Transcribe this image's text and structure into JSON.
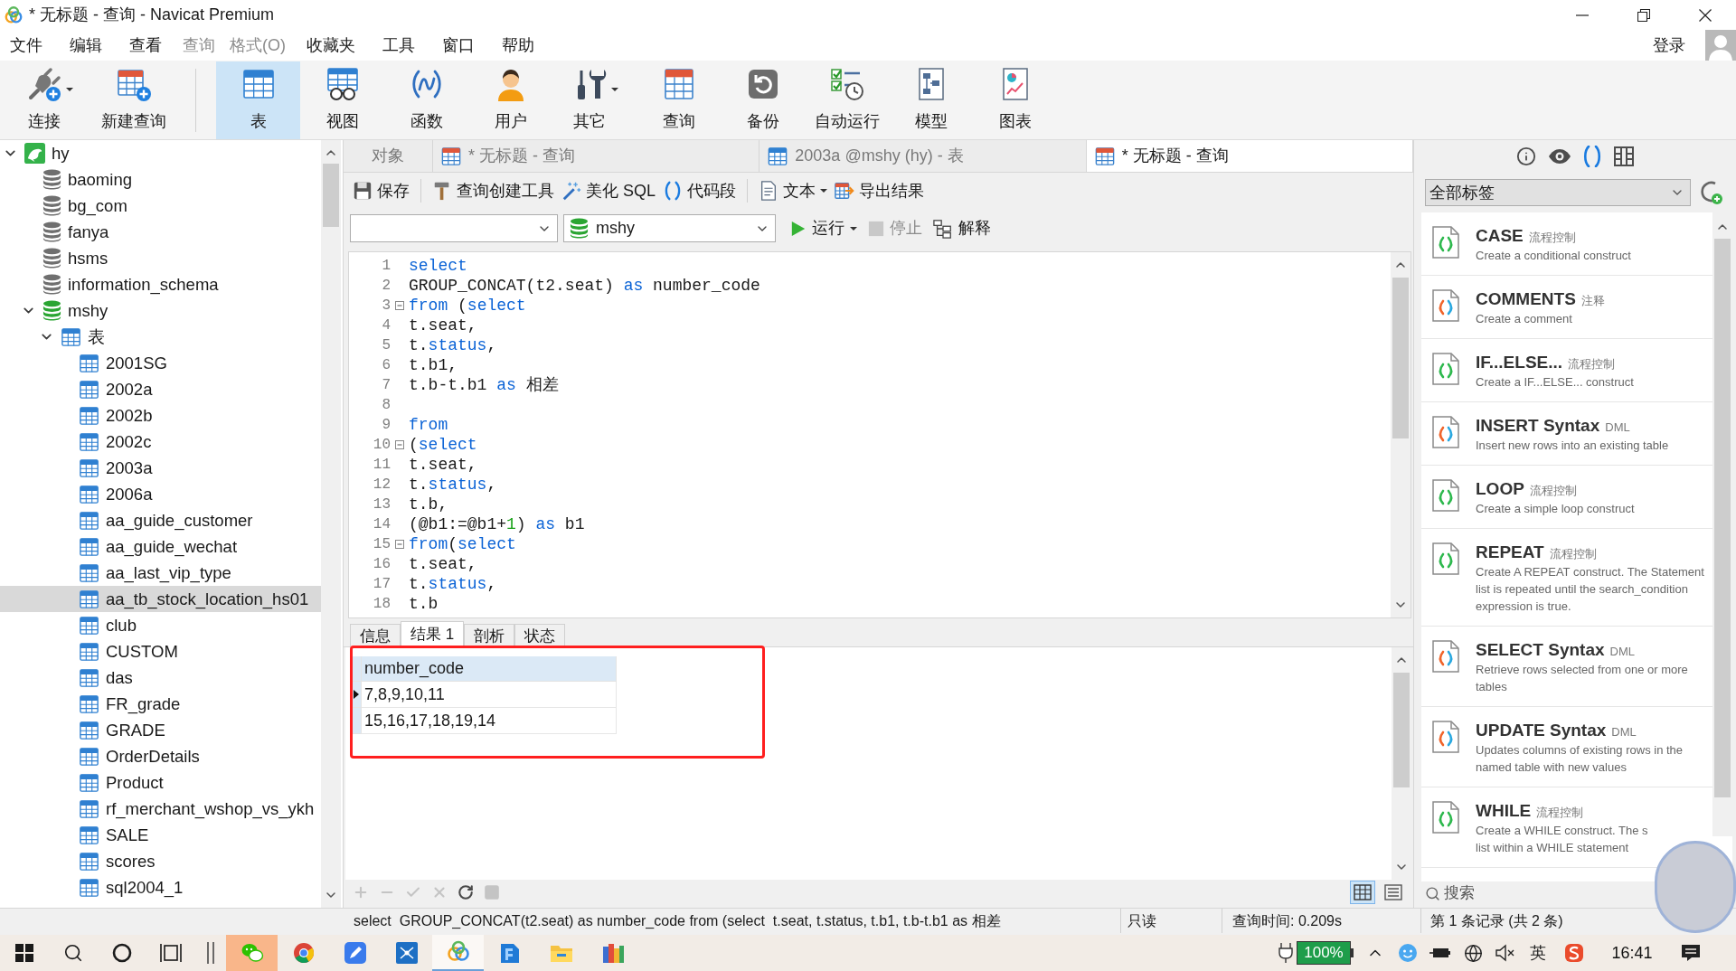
{
  "window": {
    "title": "* 无标题 - 查询 - Navicat Premium"
  },
  "menu": [
    {
      "label": "文件",
      "disabled": false
    },
    {
      "label": "编辑",
      "disabled": false
    },
    {
      "label": "查看",
      "disabled": false
    },
    {
      "label": "查询",
      "disabled": true
    },
    {
      "label": "格式(O)",
      "disabled": true
    },
    {
      "label": "收藏夹",
      "disabled": false
    },
    {
      "label": "工具",
      "disabled": false
    },
    {
      "label": "窗口",
      "disabled": false
    },
    {
      "label": "帮助",
      "disabled": false
    }
  ],
  "account": {
    "label": "登录"
  },
  "toolbar": {
    "primary": [
      {
        "label": "连接",
        "kind": "connect",
        "dropdown": true,
        "selected": false
      },
      {
        "label": "新建查询",
        "kind": "new-query",
        "dropdown": false,
        "selected": false
      }
    ],
    "objects": [
      {
        "label": "表",
        "kind": "table",
        "dropdown": false,
        "selected": true
      },
      {
        "label": "视图",
        "kind": "view",
        "dropdown": false,
        "selected": false
      },
      {
        "label": "函数",
        "kind": "function",
        "dropdown": false,
        "selected": false
      },
      {
        "label": "用户",
        "kind": "user",
        "dropdown": false,
        "selected": false
      },
      {
        "label": "其它",
        "kind": "other",
        "dropdown": true,
        "selected": false
      },
      {
        "label": "查询",
        "kind": "query",
        "dropdown": false,
        "selected": false
      },
      {
        "label": "备份",
        "kind": "backup",
        "dropdown": false,
        "selected": false
      },
      {
        "label": "自动运行",
        "kind": "automation",
        "dropdown": false,
        "selected": false
      },
      {
        "label": "模型",
        "kind": "model",
        "dropdown": false,
        "selected": false
      },
      {
        "label": "图表",
        "kind": "chart",
        "dropdown": false,
        "selected": false
      }
    ]
  },
  "tree": [
    {
      "label": "hy",
      "kind": "connection",
      "expanded": true,
      "selected": false,
      "children": [
        {
          "label": "baoming",
          "kind": "database",
          "open": false,
          "selected": false
        },
        {
          "label": "bg_com",
          "kind": "database",
          "open": false,
          "selected": false
        },
        {
          "label": "fanya",
          "kind": "database",
          "open": false,
          "selected": false
        },
        {
          "label": "hsms",
          "kind": "database",
          "open": false,
          "selected": false
        },
        {
          "label": "information_schema",
          "kind": "database",
          "open": false,
          "selected": false
        },
        {
          "label": "mshy",
          "kind": "database",
          "open": true,
          "expanded": true,
          "selected": false,
          "children": [
            {
              "label": "表",
              "kind": "group",
              "expanded": true,
              "selected": false,
              "children": [
                {
                  "label": "2001SG",
                  "kind": "table",
                  "selected": false
                },
                {
                  "label": "2002a",
                  "kind": "table",
                  "selected": false
                },
                {
                  "label": "2002b",
                  "kind": "table",
                  "selected": false
                },
                {
                  "label": "2002c",
                  "kind": "table",
                  "selected": false
                },
                {
                  "label": "2003a",
                  "kind": "table",
                  "selected": false
                },
                {
                  "label": "2006a",
                  "kind": "table",
                  "selected": false
                },
                {
                  "label": "aa_guide_customer",
                  "kind": "table",
                  "selected": false
                },
                {
                  "label": "aa_guide_wechat",
                  "kind": "table",
                  "selected": false
                },
                {
                  "label": "aa_last_vip_type",
                  "kind": "table",
                  "selected": false
                },
                {
                  "label": "aa_tb_stock_location_hs01",
                  "kind": "table",
                  "selected": true
                },
                {
                  "label": "club",
                  "kind": "table",
                  "selected": false
                },
                {
                  "label": "CUSTOM",
                  "kind": "table",
                  "selected": false
                },
                {
                  "label": "das",
                  "kind": "table",
                  "selected": false
                },
                {
                  "label": "FR_grade",
                  "kind": "table",
                  "selected": false
                },
                {
                  "label": "GRADE",
                  "kind": "table",
                  "selected": false
                },
                {
                  "label": "OrderDetails",
                  "kind": "table",
                  "selected": false
                },
                {
                  "label": "Product",
                  "kind": "table",
                  "selected": false
                },
                {
                  "label": "rf_merchant_wshop_vs_ykh",
                  "kind": "table",
                  "selected": false
                },
                {
                  "label": "SALE",
                  "kind": "table",
                  "selected": false
                },
                {
                  "label": "scores",
                  "kind": "table",
                  "selected": false
                },
                {
                  "label": "sql2004_1",
                  "kind": "table",
                  "selected": false
                }
              ]
            }
          ]
        }
      ]
    }
  ],
  "tabs": [
    {
      "label": "对象",
      "kind": "object",
      "selected": false
    },
    {
      "label": "* 无标题 - 查询",
      "kind": "query",
      "selected": false
    },
    {
      "label": "2003a @mshy (hy) - 表",
      "kind": "table",
      "selected": false
    },
    {
      "label": "* 无标题 - 查询",
      "kind": "query",
      "selected": true
    }
  ],
  "query_toolbar": [
    [
      {
        "label": "保存",
        "kind": "save",
        "dropdown": false
      }
    ],
    [
      {
        "label": "查询创建工具",
        "kind": "builder",
        "dropdown": false
      },
      {
        "label": "美化 SQL",
        "kind": "beautify",
        "dropdown": false
      },
      {
        "label": "代码段",
        "kind": "snippet",
        "dropdown": false
      }
    ],
    [
      {
        "label": "文本",
        "kind": "text",
        "dropdown": true
      },
      {
        "label": "导出结果",
        "kind": "export",
        "dropdown": false
      }
    ]
  ],
  "database_select": {
    "value": "mshy"
  },
  "run_controls": [
    {
      "label": "运行",
      "kind": "run",
      "dropdown": true,
      "disabled": false
    },
    {
      "label": "停止",
      "kind": "stop",
      "dropdown": false,
      "disabled": true
    },
    {
      "label": "解释",
      "kind": "explain",
      "dropdown": false,
      "disabled": false
    }
  ],
  "editor": {
    "lines": [
      {
        "number": "1",
        "fold": false,
        "tokens": [
          {
            "text": "select",
            "kind": "keyword"
          }
        ]
      },
      {
        "number": "2",
        "fold": false,
        "tokens": [
          {
            "text": "GROUP_CONCAT(t2.seat) ",
            "kind": "plain"
          },
          {
            "text": "as",
            "kind": "keyword"
          },
          {
            "text": " number_code",
            "kind": "plain"
          }
        ]
      },
      {
        "number": "3",
        "fold": true,
        "tokens": [
          {
            "text": "from",
            "kind": "keyword"
          },
          {
            "text": " (",
            "kind": "plain"
          },
          {
            "text": "select",
            "kind": "keyword"
          }
        ]
      },
      {
        "number": "4",
        "fold": false,
        "tokens": [
          {
            "text": "t.seat,",
            "kind": "plain"
          }
        ]
      },
      {
        "number": "5",
        "fold": false,
        "tokens": [
          {
            "text": "t.",
            "kind": "plain"
          },
          {
            "text": "status",
            "kind": "keyword"
          },
          {
            "text": ",",
            "kind": "plain"
          }
        ]
      },
      {
        "number": "6",
        "fold": false,
        "tokens": [
          {
            "text": "t.b1,",
            "kind": "plain"
          }
        ]
      },
      {
        "number": "7",
        "fold": false,
        "tokens": [
          {
            "text": "t.b-t.b1 ",
            "kind": "plain"
          },
          {
            "text": "as",
            "kind": "keyword"
          },
          {
            "text": " 相差",
            "kind": "plain"
          }
        ]
      },
      {
        "number": "8",
        "fold": false
      },
      {
        "number": "9",
        "fold": false,
        "tokens": [
          {
            "text": "from",
            "kind": "keyword"
          }
        ]
      },
      {
        "number": "10",
        "fold": true,
        "tokens": [
          {
            "text": "(",
            "kind": "plain"
          },
          {
            "text": "select",
            "kind": "keyword"
          }
        ]
      },
      {
        "number": "11",
        "fold": false,
        "tokens": [
          {
            "text": "t.seat,",
            "kind": "plain"
          }
        ]
      },
      {
        "number": "12",
        "fold": false,
        "tokens": [
          {
            "text": "t.",
            "kind": "plain"
          },
          {
            "text": "status",
            "kind": "keyword"
          },
          {
            "text": ",",
            "kind": "plain"
          }
        ]
      },
      {
        "number": "13",
        "fold": false,
        "tokens": [
          {
            "text": "t.b,",
            "kind": "plain"
          }
        ]
      },
      {
        "number": "14",
        "fold": false,
        "tokens": [
          {
            "text": "(@b1:=@b1+",
            "kind": "plain"
          },
          {
            "text": "1",
            "kind": "number"
          },
          {
            "text": ") ",
            "kind": "plain"
          },
          {
            "text": "as",
            "kind": "keyword"
          },
          {
            "text": " b1",
            "kind": "plain"
          }
        ]
      },
      {
        "number": "15",
        "fold": true,
        "tokens": [
          {
            "text": "from",
            "kind": "keyword"
          },
          {
            "text": "(",
            "kind": "plain"
          },
          {
            "text": "select",
            "kind": "keyword"
          }
        ]
      },
      {
        "number": "16",
        "fold": false,
        "tokens": [
          {
            "text": "t.seat,",
            "kind": "plain"
          }
        ]
      },
      {
        "number": "17",
        "fold": false,
        "tokens": [
          {
            "text": "t.",
            "kind": "plain"
          },
          {
            "text": "status",
            "kind": "keyword"
          },
          {
            "text": ",",
            "kind": "plain"
          }
        ]
      },
      {
        "number": "18",
        "fold": false,
        "tokens": [
          {
            "text": "t.b",
            "kind": "plain"
          }
        ]
      }
    ]
  },
  "result_tabs": [
    {
      "label": "信息",
      "selected": false
    },
    {
      "label": "结果 1",
      "selected": true
    },
    {
      "label": "剖析",
      "selected": false
    },
    {
      "label": "状态",
      "selected": false
    }
  ],
  "result_grid": {
    "columns": [
      "number_code"
    ],
    "rows": [
      {
        "cells": [
          "7,8,9,10,11"
        ],
        "selected": true
      },
      {
        "cells": [
          "15,16,17,18,19,14"
        ],
        "selected": false
      }
    ]
  },
  "grid_actions": [
    {
      "kind": "add",
      "disabled": true
    },
    {
      "kind": "remove",
      "disabled": true
    },
    {
      "kind": "apply",
      "disabled": true
    },
    {
      "kind": "cancel",
      "disabled": true
    },
    {
      "kind": "refresh",
      "disabled": false
    },
    {
      "kind": "stop",
      "disabled": true
    }
  ],
  "view_modes": [
    {
      "kind": "grid",
      "selected": true
    },
    {
      "kind": "form",
      "selected": false
    }
  ],
  "right_panel": {
    "tabs": [
      {
        "kind": "info",
        "selected": false
      },
      {
        "kind": "preview",
        "selected": false
      },
      {
        "kind": "snippets",
        "selected": true
      },
      {
        "kind": "layout",
        "selected": false
      }
    ],
    "filter": {
      "value": "全部标签"
    },
    "snippets": [
      {
        "title": "CASE",
        "tag": "流程控制",
        "description": "Create a conditional construct",
        "kind": "control"
      },
      {
        "title": "COMMENTS",
        "tag": "注释",
        "description": "Create a comment",
        "kind": "syntax"
      },
      {
        "title": "IF...ELSE...",
        "tag": "流程控制",
        "description": "Create a IF...ELSE... construct",
        "kind": "control"
      },
      {
        "title": "INSERT Syntax",
        "tag": "DML",
        "description": "Insert new rows into an existing table",
        "kind": "syntax"
      },
      {
        "title": "LOOP",
        "tag": "流程控制",
        "description": "Create a simple loop construct",
        "kind": "control"
      },
      {
        "title": "REPEAT",
        "tag": "流程控制",
        "description": "Create A REPEAT construct. The Statement list is repeated until the search_condition expression is true.",
        "kind": "control"
      },
      {
        "title": "SELECT Syntax",
        "tag": "DML",
        "description": "Retrieve rows selected from one or more tables",
        "kind": "syntax"
      },
      {
        "title": "UPDATE Syntax",
        "tag": "DML",
        "description": "Updates columns of existing rows in the named table with new values",
        "kind": "syntax"
      },
      {
        "title": "WHILE",
        "tag": "流程控制",
        "description": "Create a WHILE construct. The s\nlist within a WHILE statement",
        "kind": "control"
      }
    ],
    "search": {
      "placeholder": "搜索"
    }
  },
  "status_bar": {
    "sql": "select  GROUP_CONCAT(t2.seat) as number_code from (select  t.seat, t.status, t.b1, t.b-t.b1 as 相差",
    "mode": "只读",
    "query_time": "查询时间: 0.209s",
    "record": "第 1 条记录 (共 2 条)"
  },
  "taskbar": {
    "apps": [
      {
        "kind": "wechat",
        "flashing": true,
        "active": false
      },
      {
        "kind": "chrome",
        "flashing": false,
        "active": false
      },
      {
        "kind": "pen",
        "flashing": false,
        "active": false
      },
      {
        "kind": "network",
        "flashing": false,
        "active": false
      },
      {
        "kind": "navicat",
        "flashing": false,
        "active": true
      },
      {
        "kind": "page",
        "flashing": false,
        "active": false
      },
      {
        "kind": "explorer",
        "flashing": false,
        "active": false
      },
      {
        "kind": "books",
        "flashing": false,
        "active": false
      }
    ],
    "battery": "100%",
    "ime": "英",
    "time": "16:41"
  }
}
